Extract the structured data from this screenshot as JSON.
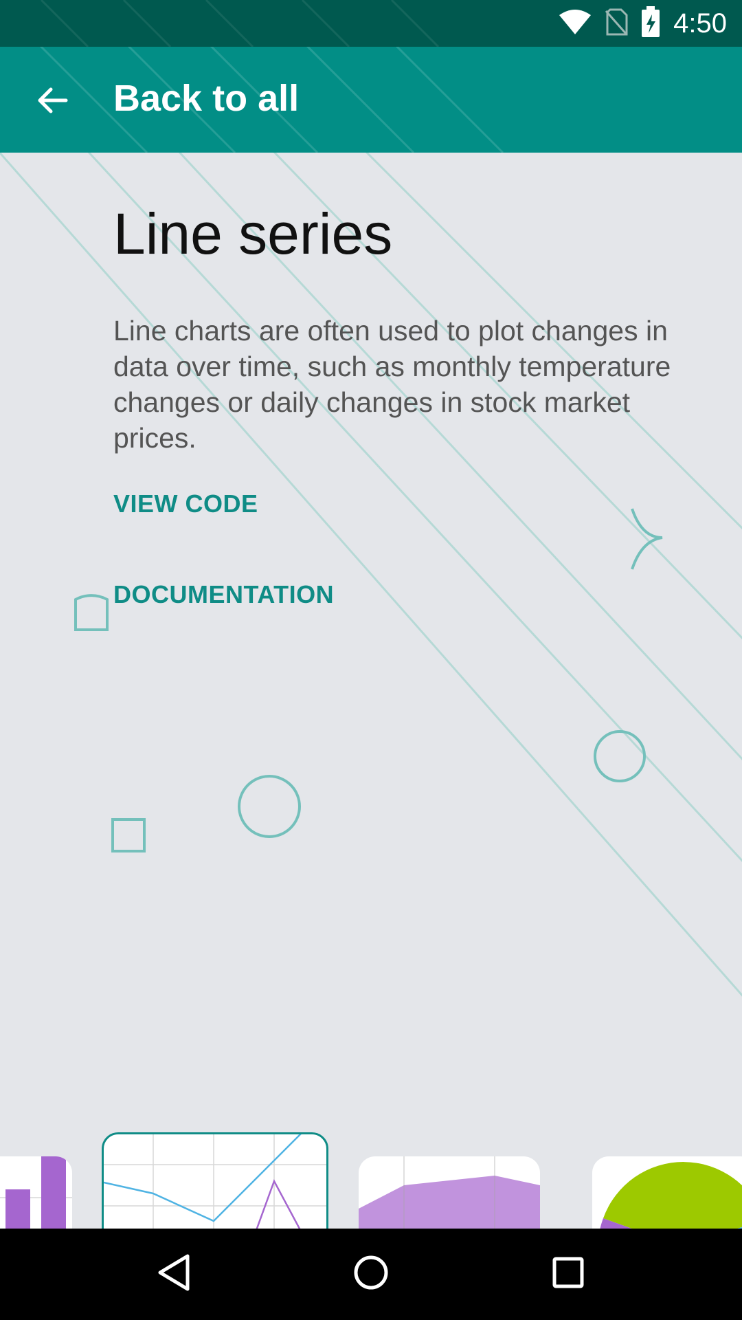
{
  "status_bar": {
    "time": "4:50",
    "icons": [
      "wifi-icon",
      "no-sim-icon",
      "battery-charging-icon"
    ]
  },
  "app_bar": {
    "back_icon": "arrow-back-icon",
    "title": "Back to all"
  },
  "main": {
    "title": "Line series",
    "description": "Line charts are often used to plot changes in data over time, such as monthly temperature changes or daily changes in stock market prices.",
    "links": {
      "view_code": "VIEW CODE",
      "documentation": "DOCUMENTATION"
    }
  },
  "carousel": {
    "items": [
      {
        "type": "column-stacked",
        "icon": "stacked-column-chart-thumbnail",
        "selected": false
      },
      {
        "type": "line",
        "icon": "line-chart-thumbnail",
        "selected": true
      },
      {
        "type": "area-stacked",
        "icon": "stacked-area-chart-thumbnail",
        "selected": false
      },
      {
        "type": "pie",
        "icon": "pie-chart-thumbnail",
        "selected": false
      }
    ],
    "expand_icon": "fullscreen-icon"
  },
  "nav_bar": {
    "icons": [
      "back-triangle-icon",
      "home-circle-icon",
      "recents-square-icon"
    ]
  },
  "colors": {
    "status_bar": "#00594f",
    "app_bar": "#028e86",
    "accent": "#0f8c86",
    "background": "#e4e6ea",
    "series_blue": "#4fb3e3",
    "series_purple": "#a566cf",
    "pie_green": "#9dc900"
  }
}
